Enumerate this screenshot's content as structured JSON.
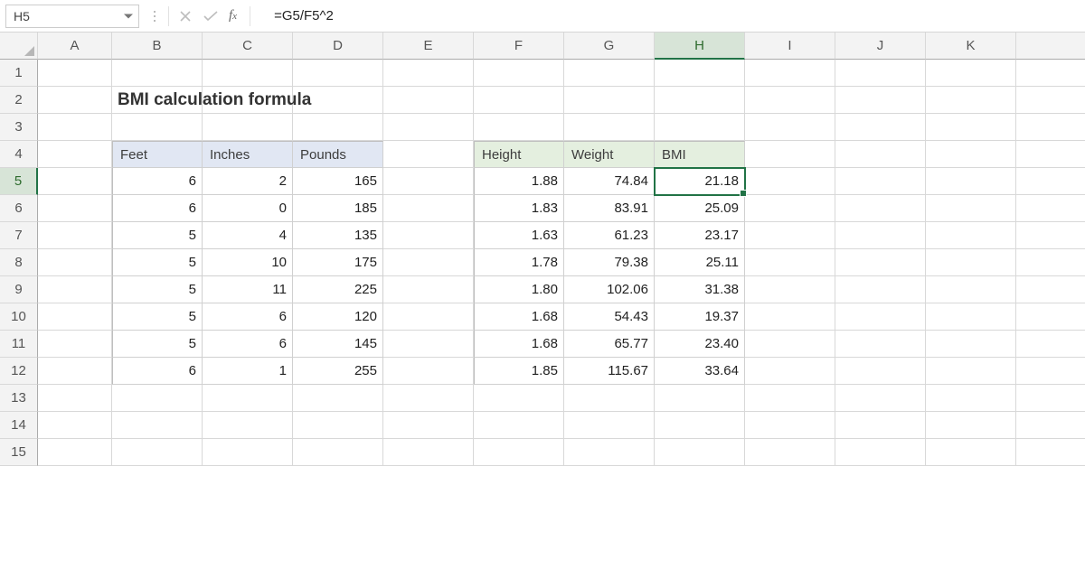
{
  "namebox": "H5",
  "formula": "=G5/F5^2",
  "columns": [
    "A",
    "B",
    "C",
    "D",
    "E",
    "F",
    "G",
    "H",
    "I",
    "J",
    "K"
  ],
  "active_col_index": 7,
  "rows": [
    1,
    2,
    3,
    4,
    5,
    6,
    7,
    8,
    9,
    10,
    11,
    12,
    13,
    14,
    15
  ],
  "active_row": 5,
  "title": "BMI calculation formula",
  "headers_left": [
    "Feet",
    "Inches",
    "Pounds"
  ],
  "headers_right": [
    "Height",
    "Weight",
    "BMI"
  ],
  "table_left": [
    [
      "6",
      "2",
      "165"
    ],
    [
      "6",
      "0",
      "185"
    ],
    [
      "5",
      "4",
      "135"
    ],
    [
      "5",
      "10",
      "175"
    ],
    [
      "5",
      "11",
      "225"
    ],
    [
      "5",
      "6",
      "120"
    ],
    [
      "5",
      "6",
      "145"
    ],
    [
      "6",
      "1",
      "255"
    ]
  ],
  "table_right": [
    [
      "1.88",
      "74.84",
      "21.18"
    ],
    [
      "1.83",
      "83.91",
      "25.09"
    ],
    [
      "1.63",
      "61.23",
      "23.17"
    ],
    [
      "1.78",
      "79.38",
      "25.11"
    ],
    [
      "1.80",
      "102.06",
      "31.38"
    ],
    [
      "1.68",
      "54.43",
      "19.37"
    ],
    [
      "1.68",
      "65.77",
      "23.40"
    ],
    [
      "1.85",
      "115.67",
      "33.64"
    ]
  ],
  "chart_data": {
    "type": "table",
    "title": "BMI calculation formula",
    "columns": [
      "Feet",
      "Inches",
      "Pounds",
      "Height",
      "Weight",
      "BMI"
    ],
    "rows": [
      [
        6,
        2,
        165,
        1.88,
        74.84,
        21.18
      ],
      [
        6,
        0,
        185,
        1.83,
        83.91,
        25.09
      ],
      [
        5,
        4,
        135,
        1.63,
        61.23,
        23.17
      ],
      [
        5,
        10,
        175,
        1.78,
        79.38,
        25.11
      ],
      [
        5,
        11,
        225,
        1.8,
        102.06,
        31.38
      ],
      [
        5,
        6,
        120,
        1.68,
        54.43,
        19.37
      ],
      [
        5,
        6,
        145,
        1.68,
        65.77,
        23.4
      ],
      [
        6,
        1,
        255,
        1.85,
        115.67,
        33.64
      ]
    ],
    "formula": "=G5/F5^2"
  }
}
